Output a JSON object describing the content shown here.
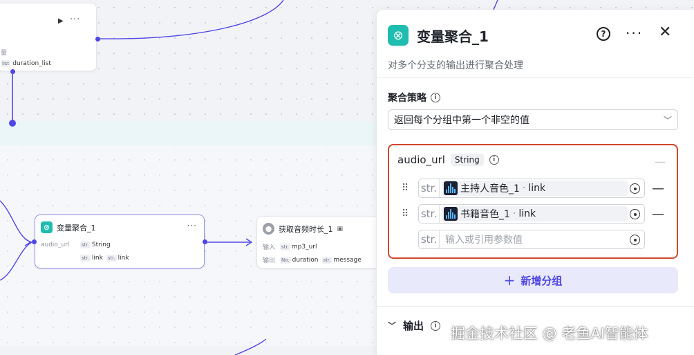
{
  "canvas": {
    "top_node": {
      "label_fragment": "量",
      "output_type_tag": "list",
      "output_name": "duration_list"
    },
    "aggregate_node": {
      "title": "变量聚合_1",
      "row_label": "audio_url",
      "type_tag": "str.",
      "type_name": "String",
      "ref_tag_1": "str.",
      "ref_name_1": "link",
      "ref_tag_2": "str.",
      "ref_name_2": "link"
    },
    "duration_node": {
      "title": "获取音频时长_1",
      "input_label": "输入",
      "input_tag": "str.",
      "input_name": "mp3_url",
      "output_label": "输出",
      "output_tag_1": "No.",
      "output_name_1": "duration",
      "output_tag_2": "str.",
      "output_name_2": "message"
    }
  },
  "panel": {
    "title": "变量聚合_1",
    "description": "对多个分支的输出进行聚合处理",
    "strategy_label": "聚合策略",
    "strategy_value": "返回每个分组中第一个非空的值",
    "group": {
      "name": "audio_url",
      "type": "String",
      "variables": [
        {
          "type_prefix": "str.",
          "source": "主持人音色_1",
          "field": "link"
        },
        {
          "type_prefix": "str.",
          "source": "书籍音色_1",
          "field": "link"
        }
      ],
      "empty_prefix": "str.",
      "empty_placeholder": "输入或引用参数值"
    },
    "add_group_label": "新增分组",
    "output_label": "输出"
  },
  "watermark": "掘金技术社区 @ 老鱼AI智能体",
  "colors": {
    "accent": "#4f46e5",
    "highlight_border": "#d2462c",
    "node_icon": "#1ebdb0"
  }
}
